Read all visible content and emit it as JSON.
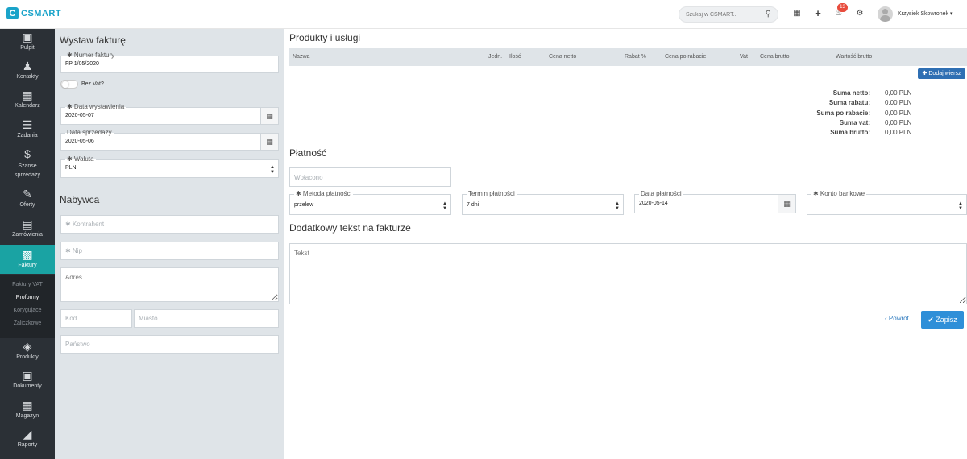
{
  "app": {
    "logo_letter": "C",
    "logo_text": "CSMART",
    "accent": "#1aa3c9"
  },
  "topbar": {
    "search_placeholder": "Szukaj w CSMART...",
    "notifications_count": "13",
    "user_name": "Krzysiek Skowronek",
    "icons": [
      "calendar-icon",
      "plus-icon",
      "bell-icon",
      "gear-icon"
    ]
  },
  "sidebar": {
    "items": [
      {
        "label": "Pulpit",
        "icon": "laptop-icon"
      },
      {
        "label": "Kontakty",
        "icon": "users-icon"
      },
      {
        "label": "Kalendarz",
        "icon": "calendar-icon"
      },
      {
        "label": "Zadania",
        "icon": "tasks-icon"
      },
      {
        "label": "Szanse sprzedaży",
        "icon": "dollar-icon"
      },
      {
        "label": "Oferty",
        "icon": "pencil-icon"
      },
      {
        "label": "Zamówienia",
        "icon": "cart-icon"
      },
      {
        "label": "Faktury",
        "icon": "money-icon"
      },
      {
        "label": "Produkty",
        "icon": "cube-icon"
      },
      {
        "label": "Dokumenty",
        "icon": "document-icon"
      },
      {
        "label": "Magazyn",
        "icon": "grid-icon"
      },
      {
        "label": "Raporty",
        "icon": "chart-icon"
      }
    ],
    "sub_items": [
      "Faktury VAT",
      "Proformy",
      "Korygujące",
      "Zaliczkowe"
    ],
    "active_color": "#1aa3a3"
  },
  "invoice": {
    "title": "Wystaw fakturę",
    "number_label": "✱ Numer faktury",
    "number_value": "FP 1/05/2020",
    "no_vat_label": "Bez Vat?",
    "issue_date_label": "✱ Data wystawienia",
    "issue_date_value": "2020-05-07",
    "sale_date_label": "Data sprzedaży",
    "sale_date_value": "2020-05-06",
    "currency_label": "✱ Waluta",
    "currency_value": "PLN"
  },
  "buyer": {
    "title": "Nabywca",
    "contractor_placeholder": "✱ Kontrahent",
    "nip_placeholder": "✱ Nip",
    "address_placeholder": "Adres",
    "code_placeholder": "Kod",
    "city_placeholder": "Miasto",
    "country_placeholder": "Państwo"
  },
  "products": {
    "title": "Produkty i usługi",
    "columns": [
      "Nazwa",
      "Jedn.",
      "Ilość",
      "Cena netto",
      "Rabat %",
      "Cena po rabacie",
      "Vat",
      "Cena brutto",
      "Wartość brutto"
    ],
    "add_row_label": "Dodaj wiersz",
    "summary": [
      {
        "label": "Suma netto:",
        "value": "0,00 PLN"
      },
      {
        "label": "Suma rabatu:",
        "value": "0,00 PLN"
      },
      {
        "label": "Suma po rabacie:",
        "value": "0,00 PLN"
      },
      {
        "label": "Suma vat:",
        "value": "0,00 PLN"
      },
      {
        "label": "Suma brutto:",
        "value": "0,00 PLN"
      }
    ]
  },
  "payment": {
    "title": "Płatność",
    "paid_placeholder": "Wpłacono",
    "method_label": "✱ Metoda płatności",
    "method_value": "przelew",
    "term_label": "Termin płatności",
    "term_value": "7 dni",
    "date_label": "Data płatności",
    "date_value": "2020-05-14",
    "account_label": "✱ Konto bankowe",
    "account_value": ""
  },
  "extra": {
    "title": "Dodatkowy tekst na fakturze",
    "text_placeholder": "Tekst"
  },
  "actions": {
    "back_label": "Powrót",
    "save_label": "Zapisz",
    "save_color": "#2f8fd8"
  }
}
